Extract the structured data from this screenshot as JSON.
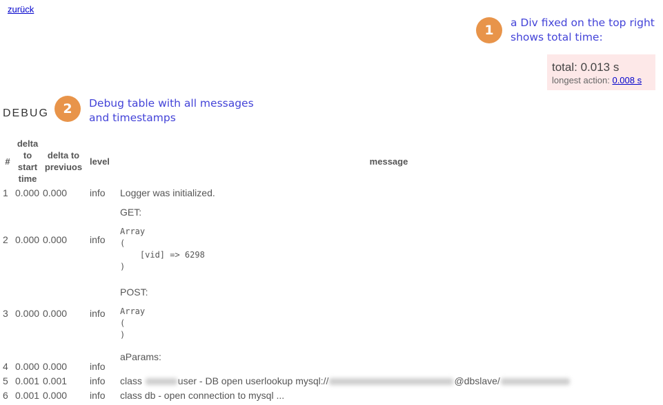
{
  "nav": {
    "back_label": "zurück"
  },
  "callouts": [
    {
      "number": "1",
      "text_line1": "a Div fixed on the top right",
      "text_line2": "shows total time:"
    },
    {
      "number": "2",
      "text_line1": "Debug table with all messages",
      "text_line2": "and timestamps"
    }
  ],
  "summary": {
    "total_label": "total: 0.013 s",
    "longest_prefix": "longest action:",
    "longest_value": "0.008 s"
  },
  "debug": {
    "title": "DEBUG",
    "headers": {
      "num": "#",
      "delta_start": "delta to start time",
      "delta_prev": "delta to previuos",
      "level": "level",
      "message": "message"
    },
    "rows": [
      {
        "n": "1",
        "start": "0.000",
        "prev": "0.000",
        "level": "info",
        "message": "Logger was initialized."
      },
      {
        "n": "2",
        "start": "0.000",
        "prev": "0.000",
        "level": "info",
        "label": "GET:",
        "pre": "Array\n(\n    [vid] => 6298\n)"
      },
      {
        "n": "3",
        "start": "0.000",
        "prev": "0.000",
        "level": "info",
        "label": "POST:",
        "pre": "Array\n(\n)"
      },
      {
        "n": "4",
        "start": "0.000",
        "prev": "0.000",
        "level": "info",
        "message": "aParams:"
      },
      {
        "n": "5",
        "start": "0.001",
        "prev": "0.001",
        "level": "info",
        "msg_part1": "class ",
        "msg_part2": "user - DB open userlookup mysql://",
        "msg_part3": "@dbslave/"
      },
      {
        "n": "6",
        "start": "0.001",
        "prev": "0.000",
        "level": "info",
        "message": "class db - open connection to mysql ..."
      }
    ]
  },
  "colors": {
    "accent_orange": "#e8944a",
    "callout_text": "#4343d8",
    "total_bg": "#fde8e8",
    "link": "#0000cc"
  }
}
